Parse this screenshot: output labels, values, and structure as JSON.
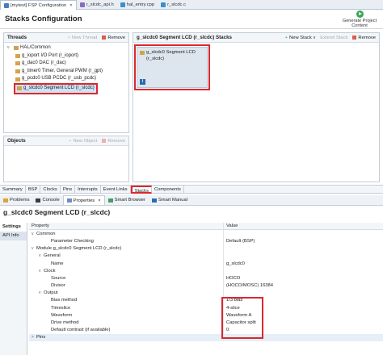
{
  "editor_tabs": [
    {
      "label": "[mytest] FSP Configuration",
      "active": true
    },
    {
      "label": "r_slcdc_api.h",
      "active": false
    },
    {
      "label": "hal_entry.cpp",
      "active": false
    },
    {
      "label": "r_slcdc.c",
      "active": false
    }
  ],
  "editor_tab_close": "×",
  "header": {
    "title": "Stacks Configuration",
    "generate_label": "Generate Project Content"
  },
  "threads": {
    "title": "Threads",
    "new_label": "New Thread",
    "remove_label": "Remove",
    "root": "HAL/Common",
    "items": [
      "g_ioport I/O Port (r_ioport)",
      "g_dac0 DAC (r_dac)",
      "g_timer0 Timer, General PWM (r_gpt)",
      "g_pcdc0 USB PCDC (r_usb_pcdc)",
      "g_slcdc0 Segment LCD (r_slcdc)"
    ]
  },
  "objects": {
    "title": "Objects",
    "new_label": "New Object",
    "remove_label": "Remove"
  },
  "stacks": {
    "title": "g_slcdc0 Segment LCD (r_slcdc) Stacks",
    "new_label": "New Stack",
    "extend_label": "Extend Stack",
    "remove_label": "Remove",
    "block_line1": "g_slcdc0 Segment LCD",
    "block_line2": "(r_slcdc)",
    "info_mark": "i"
  },
  "bottom_tabs": [
    "Summary",
    "BSP",
    "Clocks",
    "Pins",
    "Interrupts",
    "Event Links",
    "Stacks",
    "Components"
  ],
  "view_tabs": [
    {
      "label": "Problems"
    },
    {
      "label": "Console"
    },
    {
      "label": "Properties",
      "active": true
    },
    {
      "label": "Smart Browser"
    },
    {
      "label": "Smart Manual"
    }
  ],
  "properties": {
    "title": "g_slcdc0 Segment LCD (r_slcdc)",
    "side_tabs": [
      "Settings",
      "API Info"
    ],
    "col_property": "Property",
    "col_value": "Value",
    "rows": [
      {
        "name": "Common",
        "value": "",
        "indent": 0,
        "toggle": "v"
      },
      {
        "name": "Parameter Checking",
        "value": "Default (BSP)",
        "indent": 2,
        "toggle": ""
      },
      {
        "name": "Module g_slcdc0 Segment LCD (r_slcdc)",
        "value": "",
        "indent": 0,
        "toggle": "v"
      },
      {
        "name": "General",
        "value": "",
        "indent": 1,
        "toggle": "v"
      },
      {
        "name": "Name",
        "value": "g_slcdc0",
        "indent": 2,
        "toggle": ""
      },
      {
        "name": "Clock",
        "value": "",
        "indent": 1,
        "toggle": "v"
      },
      {
        "name": "Source",
        "value": "HOCO",
        "indent": 2,
        "toggle": ""
      },
      {
        "name": "Divisor",
        "value": "(HOCO/MOSC) 16384",
        "indent": 2,
        "toggle": ""
      },
      {
        "name": "Output",
        "value": "",
        "indent": 1,
        "toggle": "v"
      },
      {
        "name": "Bias method",
        "value": "1/3 bias",
        "indent": 2,
        "toggle": ""
      },
      {
        "name": "Timeslice",
        "value": "4-slice",
        "indent": 2,
        "toggle": ""
      },
      {
        "name": "Waveform",
        "value": "Waveform A",
        "indent": 2,
        "toggle": ""
      },
      {
        "name": "Drive method",
        "value": "Capacitor split",
        "indent": 2,
        "toggle": ""
      },
      {
        "name": "Default contrast (if available)",
        "value": "0",
        "indent": 2,
        "toggle": ""
      },
      {
        "name": "Pins",
        "value": "",
        "indent": 0,
        "toggle": ">"
      }
    ]
  },
  "colors": {
    "highlight": "#d9282f",
    "selection": "#cfe3f7",
    "header_bg": "#f3f6f9"
  }
}
